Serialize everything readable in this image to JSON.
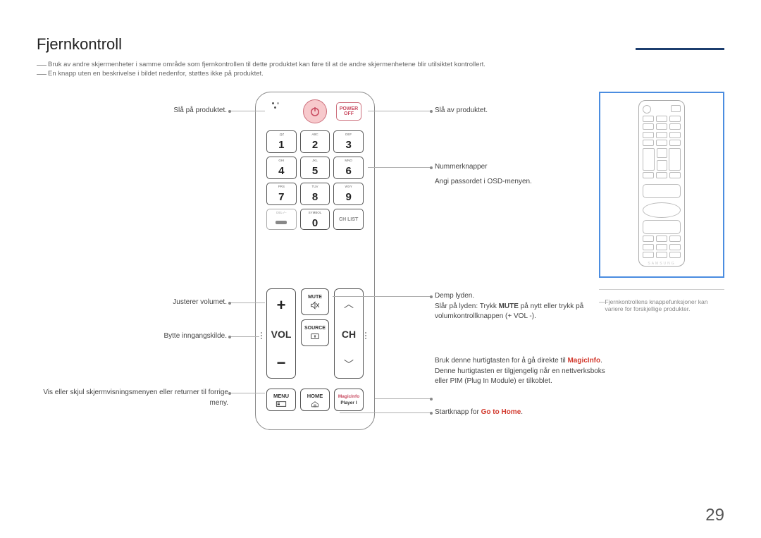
{
  "title": "Fjernkontroll",
  "notes": [
    "Bruk av andre skjermenheter i samme område som fjernkontrollen til dette produktet kan føre til at de andre skjermenhetene blir utilsiktet kontrollert.",
    "En knapp uten en beskrivelse i bildet nedenfor, støttes ikke på produktet."
  ],
  "remote": {
    "power_off": {
      "line1": "POWER",
      "line2": "OFF"
    },
    "keys": [
      {
        "sup": ".QZ",
        "num": "1"
      },
      {
        "sup": "ABC",
        "num": "2"
      },
      {
        "sup": "DEF",
        "num": "3"
      },
      {
        "sup": "GHI",
        "num": "4"
      },
      {
        "sup": "JKL",
        "num": "5"
      },
      {
        "sup": "MNO",
        "num": "6"
      },
      {
        "sup": "PRS",
        "num": "7"
      },
      {
        "sup": "TUV",
        "num": "8"
      },
      {
        "sup": "WXY",
        "num": "9"
      },
      {
        "sup": "DEL-/--",
        "bar": true,
        "gray": true
      },
      {
        "sup": "SYMBOL",
        "num": "0"
      },
      {
        "chlist": "CH LIST"
      }
    ],
    "vol": "VOL",
    "ch": "CH",
    "mute": "MUTE",
    "source": "SOURCE",
    "menu": "MENU",
    "home": "HOME",
    "magic1": "MagicInfo",
    "magic2": "Player I"
  },
  "left": {
    "power_on": "Slå på produktet.",
    "vol": "Justerer volumet.",
    "source": "Bytte inngangskilde.",
    "menu": "Vis eller skjul skjermvisningsmenyen eller returner til forrige meny."
  },
  "right": {
    "power_off": "Slå av produktet.",
    "numbers_a": "Nummerknapper",
    "numbers_b": "Angi passordet i OSD-menyen.",
    "mute_a": "Demp lyden.",
    "mute_b1": "Slår på lyden: Trykk ",
    "mute_bold": "MUTE",
    "mute_b2": " på nytt eller trykk på volumkontrollknappen (+ VOL -).",
    "magic_a": "Bruk denne hurtigtasten for å gå direkte til ",
    "magic_red": "MagicInfo",
    "magic_b": ". Denne hurtigtasten er tilgjengelig når en nettverksboks eller PIM (Plug In Module) er tilkoblet.",
    "home_a": "Startknapp for ",
    "home_red": "Go to Home",
    "home_b": "."
  },
  "thumb_note": "Fjernkontrollens knappefunksjoner kan variere for forskjellige produkter.",
  "thumb_brand": "SAMSUNG",
  "page_no": "29"
}
